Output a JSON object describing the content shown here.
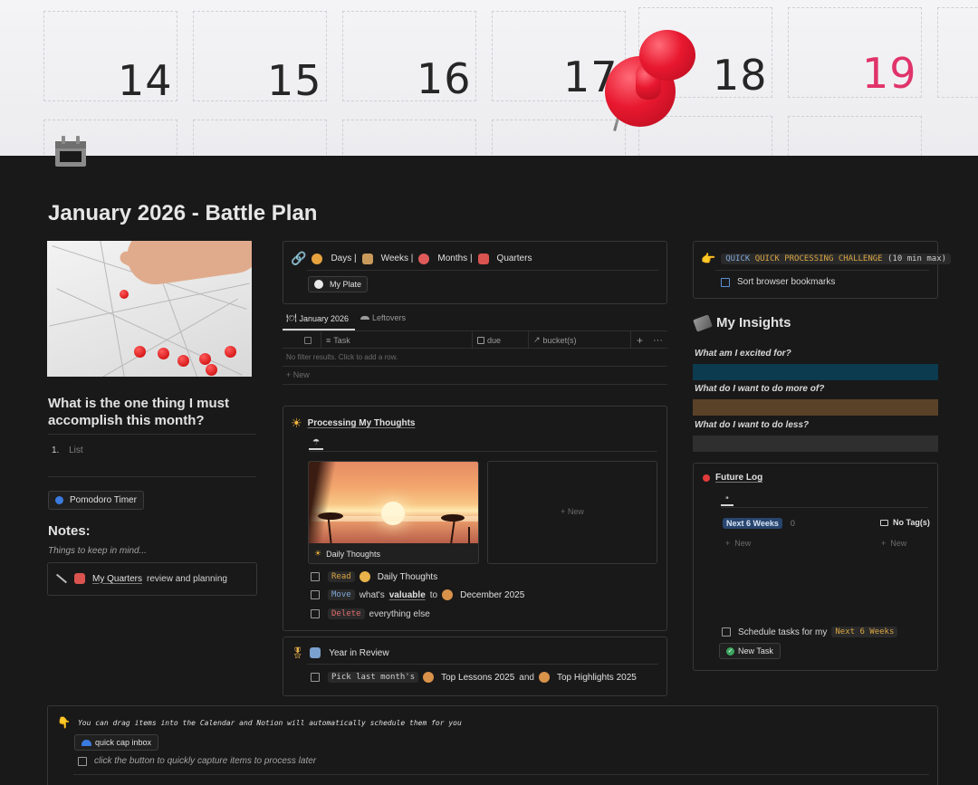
{
  "cover": {
    "day_numbers": [
      "14",
      "15",
      "16",
      "17",
      "18",
      "19"
    ]
  },
  "page": {
    "icon": "calendar-icon",
    "title": "January 2026 - Battle Plan"
  },
  "nav": {
    "items": [
      "Days |",
      "Weeks |",
      "Months |",
      "Quarters"
    ],
    "my_plate_label": "My Plate"
  },
  "database": {
    "tabs": [
      "January 2026",
      "Leftovers"
    ],
    "columns": [
      "Task",
      "due",
      "bucket(s)"
    ],
    "empty_text": "No filter results. Click to add a row.",
    "new_label": "New"
  },
  "left": {
    "one_thing_question": "What is the one thing I must accomplish this month?",
    "list_number": "1.",
    "list_placeholder": "List",
    "pomodoro_label": "Pomodoro Timer",
    "notes_heading": "Notes:",
    "notes_subtitle": "Things to keep in mind...",
    "quarters_link": "My Quarters",
    "quarters_rest": "review and planning"
  },
  "processing": {
    "title": "Processing My Thoughts",
    "gallery_new": "New",
    "gallery_card_title": "Daily Thoughts",
    "tasks": [
      {
        "tag": "Read",
        "text": "Daily Thoughts",
        "tag_color": "#d9a441"
      },
      {
        "tag": "Move",
        "pre": "what's",
        "link": "valuable",
        "mid": "to",
        "text": "December 2025",
        "tag_color": "#7fa6d6"
      },
      {
        "tag": "Delete",
        "text": "everything else",
        "tag_color": "#e06c6c"
      }
    ]
  },
  "year_review": {
    "title": "Year in Review",
    "task_code": "Pick last month's",
    "lessons": "Top Lessons 2025",
    "and": "and",
    "highlights": "Top Highlights 2025"
  },
  "quick_challenge": {
    "code_orange": "QUICK PROCESSING CHALLENGE",
    "code_rest": "(10 min max)",
    "task": "Sort browser bookmarks"
  },
  "insights": {
    "heading": "My Insights",
    "questions": [
      {
        "q": "What am I excited for?",
        "color": "#0c3a4f"
      },
      {
        "q": "What do I want to do more of?",
        "color": "#5a4228"
      },
      {
        "q": "What do I want to do less?",
        "color": "#2f2f2f"
      }
    ]
  },
  "future_log": {
    "title": "Future Log",
    "group1": "Next 6 Weeks",
    "group1_count": "0",
    "group2": "No Tag(s)",
    "new_label": "New",
    "schedule_pre": "Schedule tasks for my",
    "schedule_code": "Next 6 Weeks",
    "new_task_label": "New Task"
  },
  "bottom": {
    "drag_text": "You can drag items into the Calendar and Notion will automatically schedule them for you",
    "inbox_button": "quick cap inbox",
    "hint": "click the button to quickly capture items to process later"
  }
}
